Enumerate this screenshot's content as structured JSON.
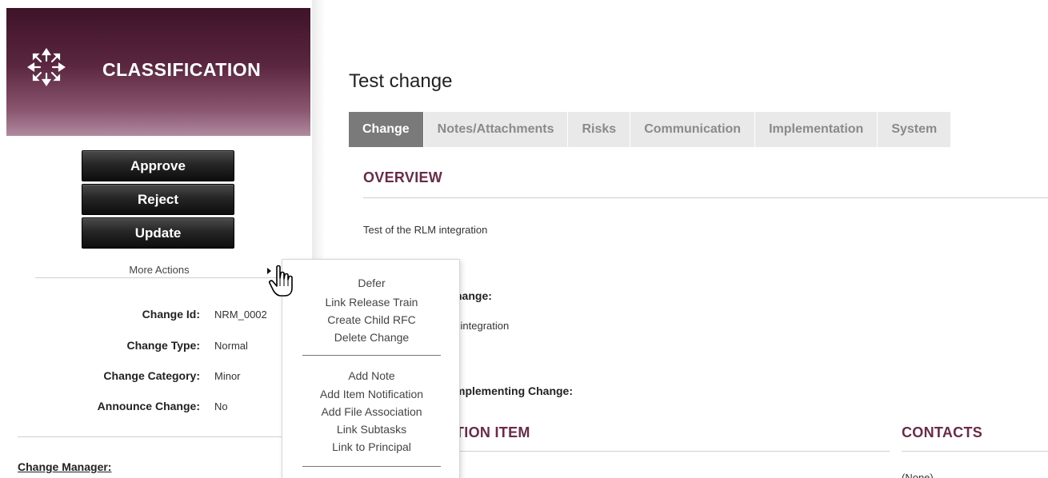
{
  "sidebar": {
    "header": {
      "title": "CLASSIFICATION",
      "icon": "move-arrows-icon"
    },
    "buttons": {
      "approve": "Approve",
      "reject": "Reject",
      "update": "Update"
    },
    "more_actions": {
      "label": "More Actions"
    },
    "fields": {
      "change_id": {
        "label": "Change Id:",
        "value": "NRM_0002"
      },
      "change_type": {
        "label": "Change Type:",
        "value": "Normal"
      },
      "change_category": {
        "label": "Change Category:",
        "value": "Minor"
      },
      "announce_change": {
        "label": "Announce Change:",
        "value": "No"
      }
    },
    "change_manager_label": "Change Manager:"
  },
  "main": {
    "title": "Test change",
    "tabs": [
      {
        "label": "Change",
        "active": true
      },
      {
        "label": "Notes/Attachments",
        "active": false
      },
      {
        "label": "Risks",
        "active": false
      },
      {
        "label": "Communication",
        "active": false
      },
      {
        "label": "Implementation",
        "active": false
      },
      {
        "label": "System",
        "active": false
      }
    ],
    "overview": {
      "heading": "OVERVIEW",
      "description": "Test of the RLM integration",
      "reason_label_partial": "hange:",
      "reason_text_partial": "l integration",
      "impact_label_partial": "mplementing Change:"
    },
    "config_item_heading_partial": "TION ITEM",
    "contacts": {
      "heading": "CONTACTS",
      "value_partial": "(None)"
    }
  },
  "dropdown": {
    "group1": [
      "Defer",
      "Link Release Train",
      "Create Child RFC",
      "Delete Change"
    ],
    "group2": [
      "Add Note",
      "Add Item Notification",
      "Add File Association",
      "Link Subtasks",
      "Link to Principal"
    ]
  },
  "colors": {
    "header_top": "#3e1328",
    "header_bottom": "#b08aa0",
    "section_heading": "#6b2a48",
    "active_tab": "#7a7a7a",
    "inactive_tab": "#e9e9e9"
  }
}
